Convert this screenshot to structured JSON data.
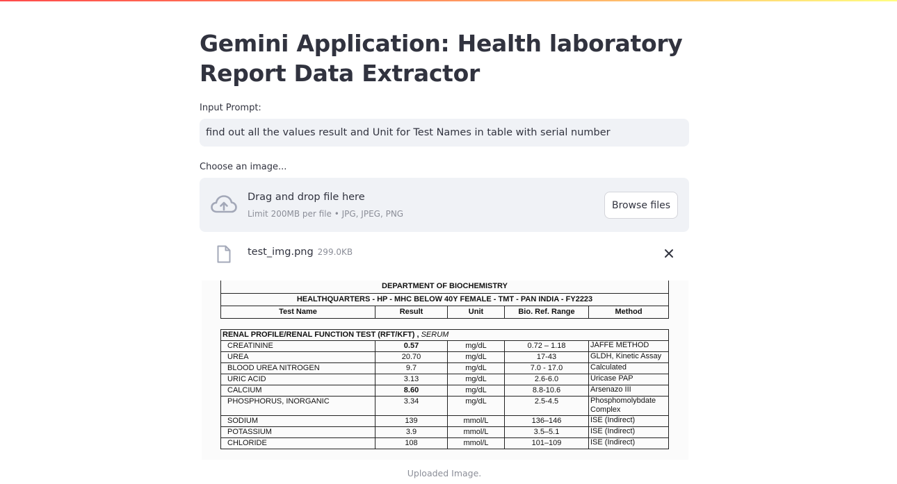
{
  "page": {
    "title": "Gemini Application: Health laboratory Report Data Extractor"
  },
  "prompt": {
    "label": "Input Prompt:",
    "value": "find out all the values result and Unit for Test Names in table with serial number"
  },
  "uploader": {
    "label": "Choose an image...",
    "drop_title": "Drag and drop file here",
    "drop_subtitle": "Limit 200MB per file • JPG, JPEG, PNG",
    "browse_label": "Browse files",
    "file_name": "test_img.png",
    "file_size": "299.0KB"
  },
  "report": {
    "department": "DEPARTMENT OF BIOCHEMISTRY",
    "subtitle": "HEALTHQUARTERS - HP - MHC BELOW 40Y FEMALE - TMT - PAN INDIA - FY2223",
    "headers": [
      "Test Name",
      "Result",
      "Unit",
      "Bio. Ref. Range",
      "Method"
    ],
    "section": "RENAL PROFILE/RENAL FUNCTION TEST (RFT/KFT) ,",
    "section_sample": "SERUM",
    "rows": [
      {
        "name": "CREATININE",
        "result": "0.57",
        "unit": "mg/dL",
        "range": "0.72 – 1.18",
        "method": "JAFFE METHOD",
        "bold": true
      },
      {
        "name": "UREA",
        "result": "20.70",
        "unit": "mg/dL",
        "range": "17-43",
        "method": "GLDH, Kinetic Assay",
        "bold": false
      },
      {
        "name": "BLOOD UREA NITROGEN",
        "result": "9.7",
        "unit": "mg/dL",
        "range": "7.0 - 17.0",
        "method": "Calculated",
        "bold": false
      },
      {
        "name": "URIC ACID",
        "result": "3.13",
        "unit": "mg/dL",
        "range": "2.6-6.0",
        "method": "Uricase PAP",
        "bold": false
      },
      {
        "name": "CALCIUM",
        "result": "8.60",
        "unit": "mg/dL",
        "range": "8.8-10.6",
        "method": "Arsenazo III",
        "bold": true
      },
      {
        "name": "PHOSPHORUS, INORGANIC",
        "result": "3.34",
        "unit": "mg/dL",
        "range": "2.5-4.5",
        "method": "Phosphomolybdate Complex",
        "bold": false
      },
      {
        "name": "SODIUM",
        "result": "139",
        "unit": "mmol/L",
        "range": "136–146",
        "method": "ISE (Indirect)",
        "bold": false
      },
      {
        "name": "POTASSIUM",
        "result": "3.9",
        "unit": "mmol/L",
        "range": "3.5–5.1",
        "method": "ISE (Indirect)",
        "bold": false
      },
      {
        "name": "CHLORIDE",
        "result": "108",
        "unit": "mmol/L",
        "range": "101–109",
        "method": "ISE (Indirect)",
        "bold": false
      }
    ]
  },
  "image_caption": "Uploaded Image."
}
